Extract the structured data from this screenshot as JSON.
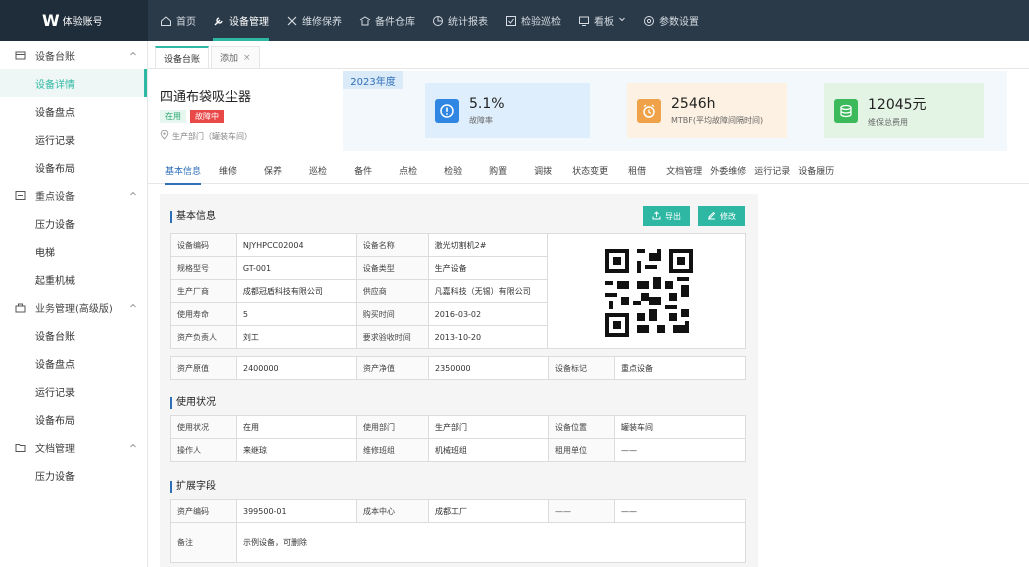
{
  "app": {
    "logo_mark": "W",
    "account": "体验账号"
  },
  "topnav": [
    {
      "label": "首页",
      "icon": "home-icon"
    },
    {
      "label": "设备管理",
      "icon": "wrench-icon",
      "active": true
    },
    {
      "label": "维修保养",
      "icon": "tools-icon"
    },
    {
      "label": "备件仓库",
      "icon": "warehouse-icon"
    },
    {
      "label": "统计报表",
      "icon": "pie-chart-icon"
    },
    {
      "label": "检验巡检",
      "icon": "inspection-icon"
    },
    {
      "label": "看板",
      "icon": "monitor-icon"
    },
    {
      "label": "参数设置",
      "icon": "gear-icon"
    }
  ],
  "sidebar": {
    "groups": [
      {
        "label": "设备台账",
        "items": [
          "设备详情",
          "设备盘点",
          "运行记录",
          "设备布局"
        ]
      },
      {
        "label": "重点设备",
        "items": [
          "压力设备",
          "电梯",
          "起重机械"
        ]
      },
      {
        "label": "业务管理(高级版)",
        "items": [
          "设备台账",
          "设备盘点",
          "运行记录",
          "设备布局"
        ]
      },
      {
        "label": "文档管理",
        "items": [
          "压力设备"
        ]
      }
    ],
    "active_item": "设备详情"
  },
  "tabs": [
    {
      "label": "设备台账"
    },
    {
      "label": "添加",
      "close": "×"
    }
  ],
  "equipment": {
    "name": "四通布袋吸尘器",
    "status": "在用",
    "alarm": "故障中",
    "department": "生产部门（罐装车间）"
  },
  "year_label": "2023年度",
  "kpis": [
    {
      "value": "5.1%",
      "label": "故障率",
      "color": "#2f86e3"
    },
    {
      "value": "2546h",
      "label": "MTBF(平均故障间隔时间)",
      "color": "#f0a248"
    },
    {
      "value": "12045元",
      "label": "维保总费用",
      "color": "#3cb95b"
    }
  ],
  "detail_tabs": [
    "基本信息",
    "维修",
    "保养",
    "巡检",
    "备件",
    "点检",
    "检验",
    "购置",
    "调拨",
    "状态变更",
    "租借",
    "文档管理",
    "外委维修",
    "运行记录",
    "设备履历"
  ],
  "sections": {
    "basic": "基本信息",
    "usage": "使用状况",
    "extend": "扩展字段"
  },
  "buttons": {
    "export": "导出",
    "edit": "修改"
  },
  "basic_info": {
    "rows": [
      [
        "设备编码",
        "NJYHPCC02004",
        "设备名称",
        "激光切割机2#"
      ],
      [
        "规格型号",
        "GT-001",
        "设备类型",
        "生产设备"
      ],
      [
        "生产厂商",
        "成都冠盾科技有限公司",
        "供应商",
        "凡嘉科技（无锡）有限公司"
      ],
      [
        "使用寿命",
        "5",
        "购买时间",
        "2016-03-02"
      ],
      [
        "资产负责人",
        "刘工",
        "要求验收时间",
        "2013-10-20"
      ]
    ],
    "last_row": [
      "资产原值",
      "2400000",
      "资产净值",
      "2350000",
      "设备标记",
      "重点设备"
    ]
  },
  "usage_info": {
    "rows": [
      [
        "使用状况",
        "在用",
        "使用部门",
        "生产部门",
        "设备位置",
        "罐装车间"
      ],
      [
        "操作人",
        "来继琼",
        "维修班组",
        "机械班组",
        "租用单位",
        "——"
      ]
    ]
  },
  "extend_info": {
    "row": [
      "资产编码",
      "399500-01",
      "成本中心",
      "成都工厂",
      "——",
      "——"
    ],
    "remark_label": "备注",
    "remark_value": "示例设备，可删除"
  }
}
